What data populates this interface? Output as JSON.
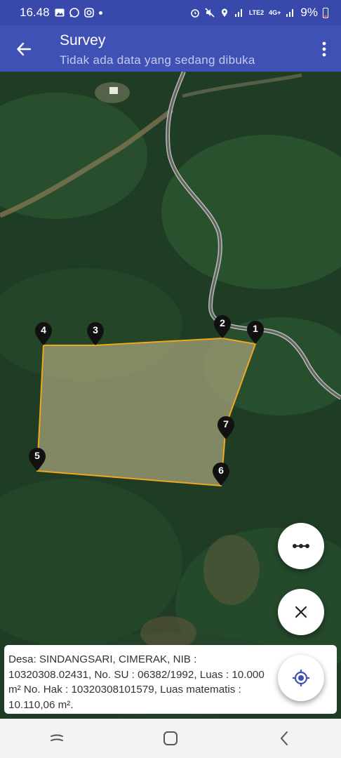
{
  "status_bar": {
    "time": "16.48",
    "battery": "9%",
    "network_label": "LTE2",
    "network_4g": "4G+"
  },
  "app_bar": {
    "title": "Survey",
    "subtitle": "Tidak ada data yang sedang dibuka"
  },
  "map": {
    "type": "satellite",
    "parcel_fill": "#a9a57c",
    "parcel_stroke": "#f0a71d",
    "markers": [
      {
        "label": "1"
      },
      {
        "label": "2"
      },
      {
        "label": "3"
      },
      {
        "label": "4"
      },
      {
        "label": "5"
      },
      {
        "label": "6"
      },
      {
        "label": "7"
      }
    ]
  },
  "info": {
    "text": "Desa: SINDANGSARI, CIMERAK, NIB : 10320308.02431, No. SU : 06382/1992, Luas : 10.000 m² No. Hak : 10320308101579, Luas matematis : 10.110,06 m²."
  },
  "fabs": {
    "more_icon": "more-horizontal-icon",
    "close_icon": "close-icon",
    "locate_icon": "my-location-icon"
  },
  "nav": {
    "recent_icon": "recent-apps-icon",
    "home_icon": "home-icon",
    "back_icon": "back-icon"
  }
}
